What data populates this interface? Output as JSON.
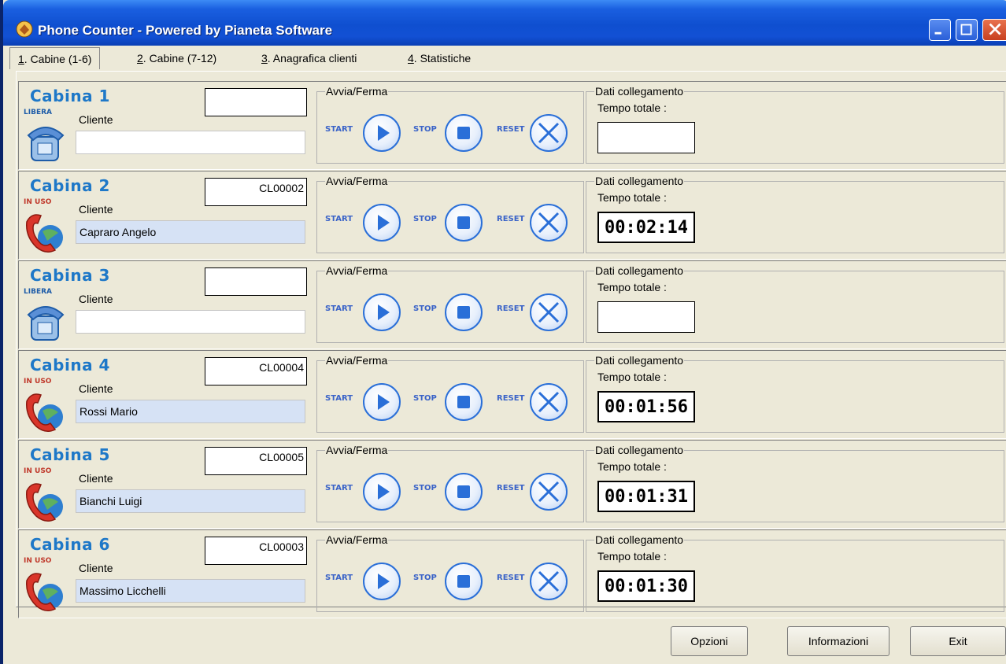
{
  "window": {
    "title": "Phone Counter - Powered by Pianeta Software"
  },
  "tabs": [
    {
      "key": "1",
      "label": ". Cabine (1-6)"
    },
    {
      "key": "2",
      "label": ". Cabine (7-12)"
    },
    {
      "key": "3",
      "label": ". Anagrafica clienti"
    },
    {
      "key": "4",
      "label": ". Statistiche"
    }
  ],
  "labels": {
    "cliente": "Cliente",
    "avvia_ferma": "Avvia/Ferma",
    "dati_collegamento": "Dati collegamento",
    "tempo_totale": "Tempo totale :",
    "start": "START",
    "stop": "STOP",
    "reset": "RESET"
  },
  "cabine": [
    {
      "name": "Cabina 1",
      "status": "LIBERA",
      "code": "",
      "cliente": "",
      "tempo": ""
    },
    {
      "name": "Cabina 2",
      "status": "IN USO",
      "code": "CL00002",
      "cliente": "Capraro Angelo",
      "tempo": "00:02:14"
    },
    {
      "name": "Cabina 3",
      "status": "LIBERA",
      "code": "",
      "cliente": "",
      "tempo": ""
    },
    {
      "name": "Cabina 4",
      "status": "IN USO",
      "code": "CL00004",
      "cliente": "Rossi Mario",
      "tempo": "00:01:56"
    },
    {
      "name": "Cabina 5",
      "status": "IN USO",
      "code": "CL00005",
      "cliente": "Bianchi Luigi",
      "tempo": "00:01:31"
    },
    {
      "name": "Cabina 6",
      "status": "IN USO",
      "code": "CL00003",
      "cliente": "Massimo Licchelli",
      "tempo": "00:01:30"
    }
  ],
  "buttons": {
    "opzioni": "Opzioni",
    "informazioni": "Informazioni",
    "exit": "Exit"
  },
  "colors": {
    "title_bar": "#0F4FD0",
    "cabina_title": "#1E78C8",
    "libera": "#1E5CA8",
    "in_uso": "#C0392B",
    "ctrl_blue": "#2A6FD8"
  },
  "icons": {
    "app": "app-logo-icon",
    "libera_phone": "blue-phone-icon",
    "inuso_phone": "red-phone-icon",
    "start": "play-icon",
    "stop": "stop-icon",
    "reset": "x-icon"
  }
}
